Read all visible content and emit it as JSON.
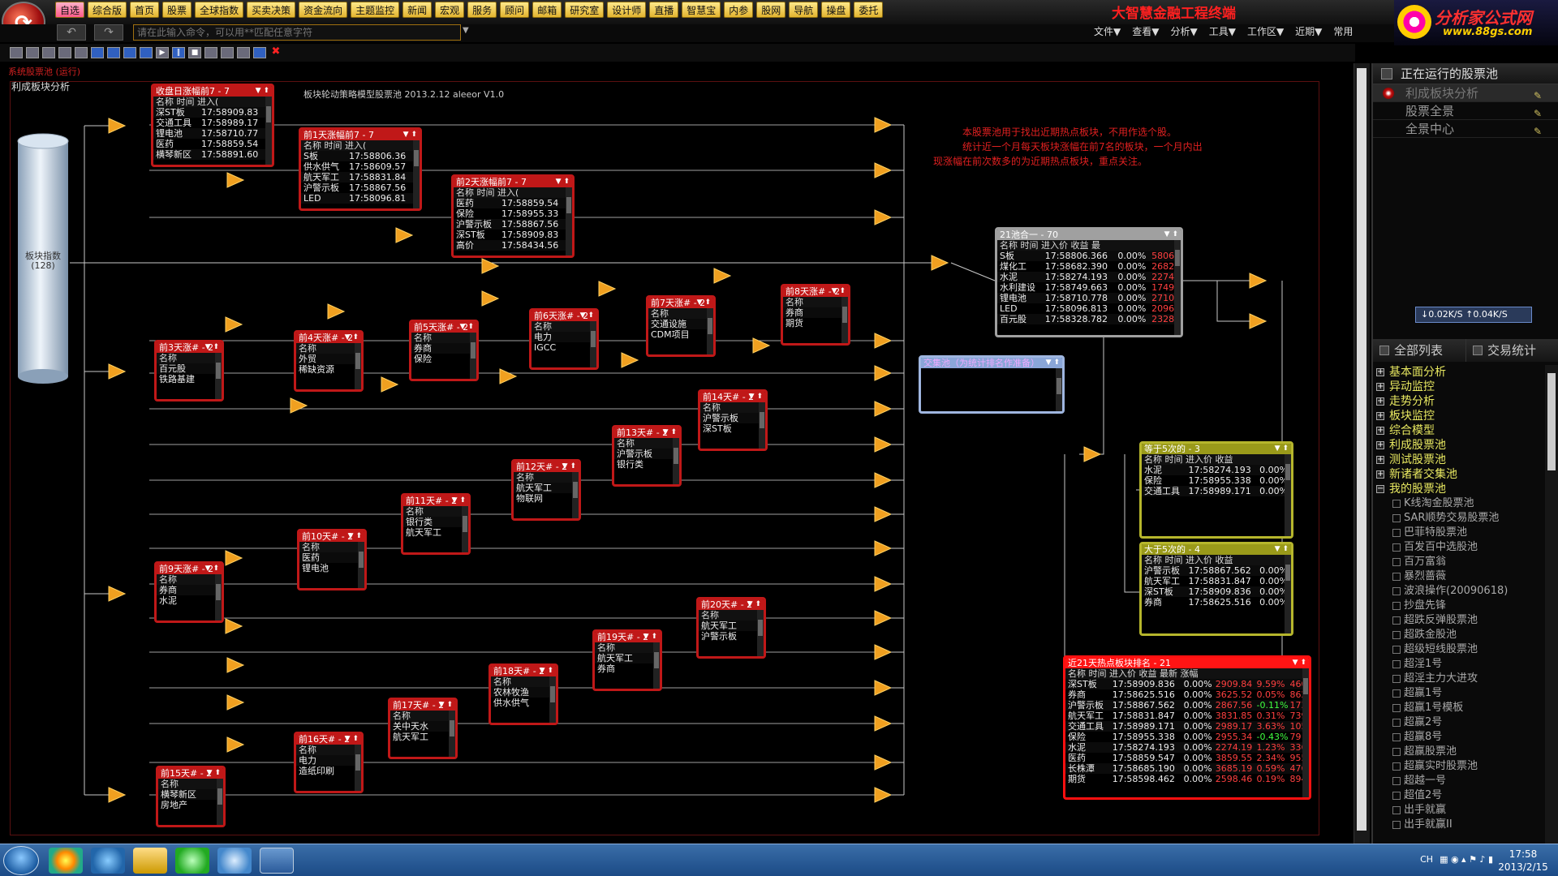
{
  "menu": {
    "items": [
      "自选",
      "综合版",
      "首页",
      "股票",
      "全球指数",
      "买卖决策",
      "资金流向",
      "主题监控",
      "新闻",
      "宏观",
      "服务",
      "顾问",
      "邮箱",
      "研究室",
      "设计师",
      "直播",
      "智慧宝",
      "内参",
      "股网",
      "导航",
      "操盘",
      "委托"
    ],
    "app_title": "大智慧金融工程终端",
    "right_items": [
      "文件▼",
      "查看▼",
      "分析▼",
      "工具▼",
      "工作区▼",
      "近期▼",
      "常用"
    ]
  },
  "brand": {
    "name": "分析家公式网",
    "url": "www.88gs.com"
  },
  "command": {
    "placeholder": "请在此输入命令，可以用**匹配任意字符"
  },
  "canvas": {
    "sys_label": "系统股票池 (运行)",
    "model_title": "利成板块分析",
    "caption": "板块轮动策略模型股票池  2013.2.12 aleeor V1.0",
    "desc": [
      "本股票池用于找出近期热点板块，不用作选个股。",
      "统计近一个月每天板块涨幅在前7名的板块，一个月内出",
      "现涨幅在前次数多的为近期热点板块，重点关注。"
    ],
    "cylinder": {
      "label1": "板块指数",
      "label2": "(128)"
    }
  },
  "pools": [
    {
      "id": "p-close",
      "title": "收盘日涨幅前7 - 7",
      "cols": "名称     时间 进入(",
      "rows": [
        [
          "深ST板",
          "17:58909.83"
        ],
        [
          "交通工具",
          "17:58989.17"
        ],
        [
          "锂电池",
          "17:58710.77"
        ],
        [
          "医药",
          "17:58859.54"
        ],
        [
          "横琴新区",
          "17:58891.60"
        ]
      ]
    },
    {
      "id": "p-d1",
      "title": "前1天涨幅前7 - 7",
      "cols": "名称     时间 进入(",
      "rows": [
        [
          "S板",
          "17:58806.36"
        ],
        [
          "供水供气",
          "17:58609.57"
        ],
        [
          "航天军工",
          "17:58831.84"
        ],
        [
          "沪警示板",
          "17:58867.56"
        ],
        [
          "LED",
          "17:58096.81"
        ]
      ]
    },
    {
      "id": "p-d2",
      "title": "前2天涨幅前7 - 7",
      "cols": "名称     时间 进入(",
      "rows": [
        [
          "医药",
          "17:58859.54"
        ],
        [
          "保险",
          "17:58955.33"
        ],
        [
          "沪警示板",
          "17:58867.56"
        ],
        [
          "深ST板",
          "17:58909.83"
        ],
        [
          "高价",
          "17:58434.56"
        ]
      ]
    },
    {
      "id": "p-d3",
      "title": "前3天涨# - 2",
      "cols": "名称",
      "rows": [
        [
          "百元股"
        ],
        [
          "铁路基建"
        ]
      ]
    },
    {
      "id": "p-d4",
      "title": "前4天涨# - 2",
      "cols": "名称",
      "rows": [
        [
          "外贸"
        ],
        [
          "稀缺资源"
        ]
      ]
    },
    {
      "id": "p-d5",
      "title": "前5天涨# - 2",
      "cols": "名称",
      "rows": [
        [
          "券商"
        ],
        [
          "保险"
        ]
      ]
    },
    {
      "id": "p-d6",
      "title": "前6天涨# - 2",
      "cols": "名称",
      "rows": [
        [
          "电力"
        ],
        [
          "IGCC"
        ]
      ]
    },
    {
      "id": "p-d7",
      "title": "前7天涨# - 2",
      "cols": "名称",
      "rows": [
        [
          "交通设施"
        ],
        [
          "CDM项目"
        ]
      ]
    },
    {
      "id": "p-d8",
      "title": "前8天涨# - 2",
      "cols": "名称",
      "rows": [
        [
          "券商"
        ],
        [
          "期货"
        ]
      ]
    },
    {
      "id": "p-d9",
      "title": "前9天涨# - 2",
      "cols": "名称",
      "rows": [
        [
          "券商"
        ],
        [
          "水泥"
        ]
      ]
    },
    {
      "id": "p-d10",
      "title": "前10天# - 2",
      "cols": "名称",
      "rows": [
        [
          "医药"
        ],
        [
          "锂电池"
        ]
      ]
    },
    {
      "id": "p-d11",
      "title": "前11天# - 2",
      "cols": "名称",
      "rows": [
        [
          "银行类"
        ],
        [
          "航天军工"
        ]
      ]
    },
    {
      "id": "p-d12",
      "title": "前12天# - 2",
      "cols": "名称",
      "rows": [
        [
          "航天军工"
        ],
        [
          "物联网"
        ]
      ]
    },
    {
      "id": "p-d13",
      "title": "前13天# - 2",
      "cols": "名称",
      "rows": [
        [
          "沪警示板"
        ],
        [
          "银行类"
        ]
      ]
    },
    {
      "id": "p-d14",
      "title": "前14天# - 2",
      "cols": "名称",
      "rows": [
        [
          "沪警示板"
        ],
        [
          "深ST板"
        ]
      ]
    },
    {
      "id": "p-d15",
      "title": "前15天# - 2",
      "cols": "名称",
      "rows": [
        [
          "横琴新区"
        ],
        [
          "房地产"
        ]
      ]
    },
    {
      "id": "p-d16",
      "title": "前16天# - 2",
      "cols": "名称",
      "rows": [
        [
          "电力"
        ],
        [
          "造纸印刷"
        ]
      ]
    },
    {
      "id": "p-d17",
      "title": "前17天# - 2",
      "cols": "名称",
      "rows": [
        [
          "关中天水"
        ],
        [
          "航天军工"
        ]
      ]
    },
    {
      "id": "p-d18",
      "title": "前18天# - 2",
      "cols": "名称",
      "rows": [
        [
          "农林牧渔"
        ],
        [
          "供水供气"
        ]
      ]
    },
    {
      "id": "p-d19",
      "title": "前19天# - 2",
      "cols": "名称",
      "rows": [
        [
          "航天军工"
        ],
        [
          "券商"
        ]
      ]
    },
    {
      "id": "p-d20",
      "title": "前20天# - 2",
      "cols": "名称",
      "rows": [
        [
          "航天军工"
        ],
        [
          "沪警示板"
        ]
      ]
    }
  ],
  "merge_pool": {
    "title": "21池合一 - 70",
    "cols": "名称     时间 进入价   收益    最",
    "rows": [
      [
        "S板",
        "17:58806.366",
        "0.00%",
        "5806"
      ],
      [
        "煤化工",
        "17:58682.390",
        "0.00%",
        "2682"
      ],
      [
        "水泥",
        "17:58274.193",
        "0.00%",
        "2274"
      ],
      [
        "水利建设",
        "17:58749.663",
        "0.00%",
        "1749"
      ],
      [
        "锂电池",
        "17:58710.778",
        "0.00%",
        "2710"
      ],
      [
        "LED",
        "17:58096.813",
        "0.00%",
        "2096"
      ],
      [
        "百元股",
        "17:58328.782",
        "0.00%",
        "2328"
      ]
    ]
  },
  "blank_pool": {
    "title": "交集池（为统计排名作准备）"
  },
  "eq5_pool": {
    "title": "等于5次的 - 3",
    "cols": "名称     时间 进入价  收益",
    "rows": [
      [
        "水泥",
        "17:58274.193",
        "0.00%"
      ],
      [
        "保险",
        "17:58955.338",
        "0.00%"
      ],
      [
        "交通工具",
        "17:58989.171",
        "0.00%"
      ]
    ]
  },
  "gt5_pool": {
    "title": "大于5次的 - 4",
    "cols": "名称     时间 进入价  收益",
    "rows": [
      [
        "沪警示板",
        "17:58867.562",
        "0.00%"
      ],
      [
        "航天军工",
        "17:58831.847",
        "0.00%"
      ],
      [
        "深ST板",
        "17:58909.836",
        "0.00%"
      ],
      [
        "券商",
        "17:58625.516",
        "0.00%"
      ]
    ]
  },
  "hot_pool": {
    "title": "近21天热点板块排名 - 21",
    "cols": "名称     时间 进入价  收益   最新   涨幅",
    "rows": [
      [
        "深ST板",
        "17:58909.836",
        "0.00%",
        "2909.84",
        "9.59%",
        "460"
      ],
      [
        "券商",
        "17:58625.516",
        "0.00%",
        "3625.52",
        "0.05%",
        "862"
      ],
      [
        "沪警示板",
        "17:58867.562",
        "0.00%",
        "2867.56",
        "-0.11%",
        "173"
      ],
      [
        "航天军工",
        "17:58831.847",
        "0.00%",
        "3831.85",
        "0.31%",
        "739"
      ],
      [
        "交通工具",
        "17:58989.171",
        "0.00%",
        "2989.17",
        "3.63%",
        "105"
      ],
      [
        "保险",
        "17:58955.338",
        "0.00%",
        "2955.34",
        "-0.43%",
        "79"
      ],
      [
        "水泥",
        "17:58274.193",
        "0.00%",
        "2274.19",
        "1.23%",
        "336"
      ],
      [
        "医药",
        "17:58859.547",
        "0.00%",
        "3859.55",
        "2.34%",
        "955"
      ],
      [
        "长株潭",
        "17:58685.190",
        "0.00%",
        "3685.19",
        "0.59%",
        "476"
      ],
      [
        "期货",
        "17:58598.462",
        "0.00%",
        "2598.46",
        "0.19%",
        "894"
      ]
    ]
  },
  "right_panel": {
    "running_title": "正在运行的股票池",
    "running": [
      "利成板块分析",
      "股票全景",
      "全景中心"
    ],
    "speed": "↓0.02K/S ↑0.04K/S",
    "tab_all": "全部列表",
    "tab_trade": "交易统计",
    "tree_roots": [
      "基本面分析",
      "异动监控",
      "走势分析",
      "板块监控",
      "综合模型",
      "利成股票池",
      "测试股票池",
      "新诸者交集池",
      "我的股票池"
    ],
    "tree_children": [
      "K线淘金股票池",
      "SAR顺势交易股票池",
      "巴菲特股票池",
      "百发百中选股池",
      "百万富翁",
      "暴烈蔷薇",
      "波浪操作(20090618)",
      "抄盘先锋",
      "超跌反弹股票池",
      "超跌金股池",
      "超级短线股票池",
      "超淫1号",
      "超淫主力大进攻",
      "超赢1号",
      "超赢1号模板",
      "超赢2号",
      "超赢8号",
      "超赢股票池",
      "超赢实时股票池",
      "超越一号",
      "超值2号",
      "出手就赢",
      "出手就赢II"
    ]
  },
  "taskbar": {
    "time": "17:58",
    "date": "2013/2/15",
    "tray": "CH"
  }
}
